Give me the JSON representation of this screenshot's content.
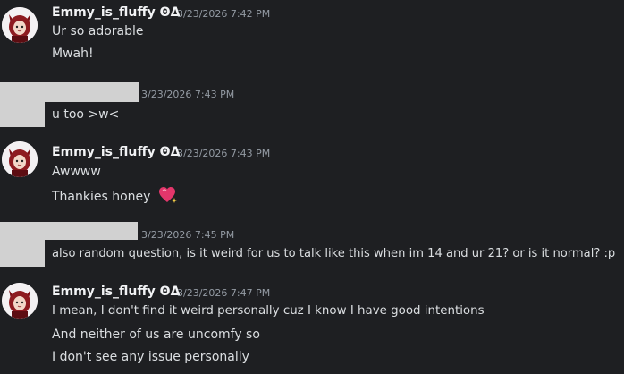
{
  "messages": [
    {
      "author": "Emmy_is_fluffy ΘΔ",
      "timestamp": "3/23/2026 7:42 PM",
      "lines": [
        "Ur so adorable",
        "Mwah!"
      ]
    },
    {
      "author": "",
      "timestamp": "3/23/2026 7:43 PM",
      "lines": [
        "u too >w<"
      ]
    },
    {
      "author": "Emmy_is_fluffy ΘΔ",
      "timestamp": "3/23/2026 7:43 PM",
      "lines": [
        "Awwww",
        "Thankies honey"
      ],
      "emoji": "sparkling-heart-icon"
    },
    {
      "author": "",
      "timestamp": "3/23/2026 7:45 PM",
      "lines": [
        "also random question, is it weird for us to talk like this when im 14 and ur 21? or is it normal? :p"
      ]
    },
    {
      "author": "Emmy_is_fluffy ΘΔ",
      "timestamp": "3/23/2026 7:47 PM",
      "lines": [
        "I mean, I don't find it weird personally cuz I know I have good intentions",
        "And neither of us are uncomfy so",
        "I don't see any issue personally"
      ]
    }
  ],
  "colors": {
    "background": "#1e1f22",
    "username": "#f2f3f5",
    "timestamp": "#949ba4",
    "text": "#dbdee1",
    "redaction": "#d1d1d1"
  }
}
